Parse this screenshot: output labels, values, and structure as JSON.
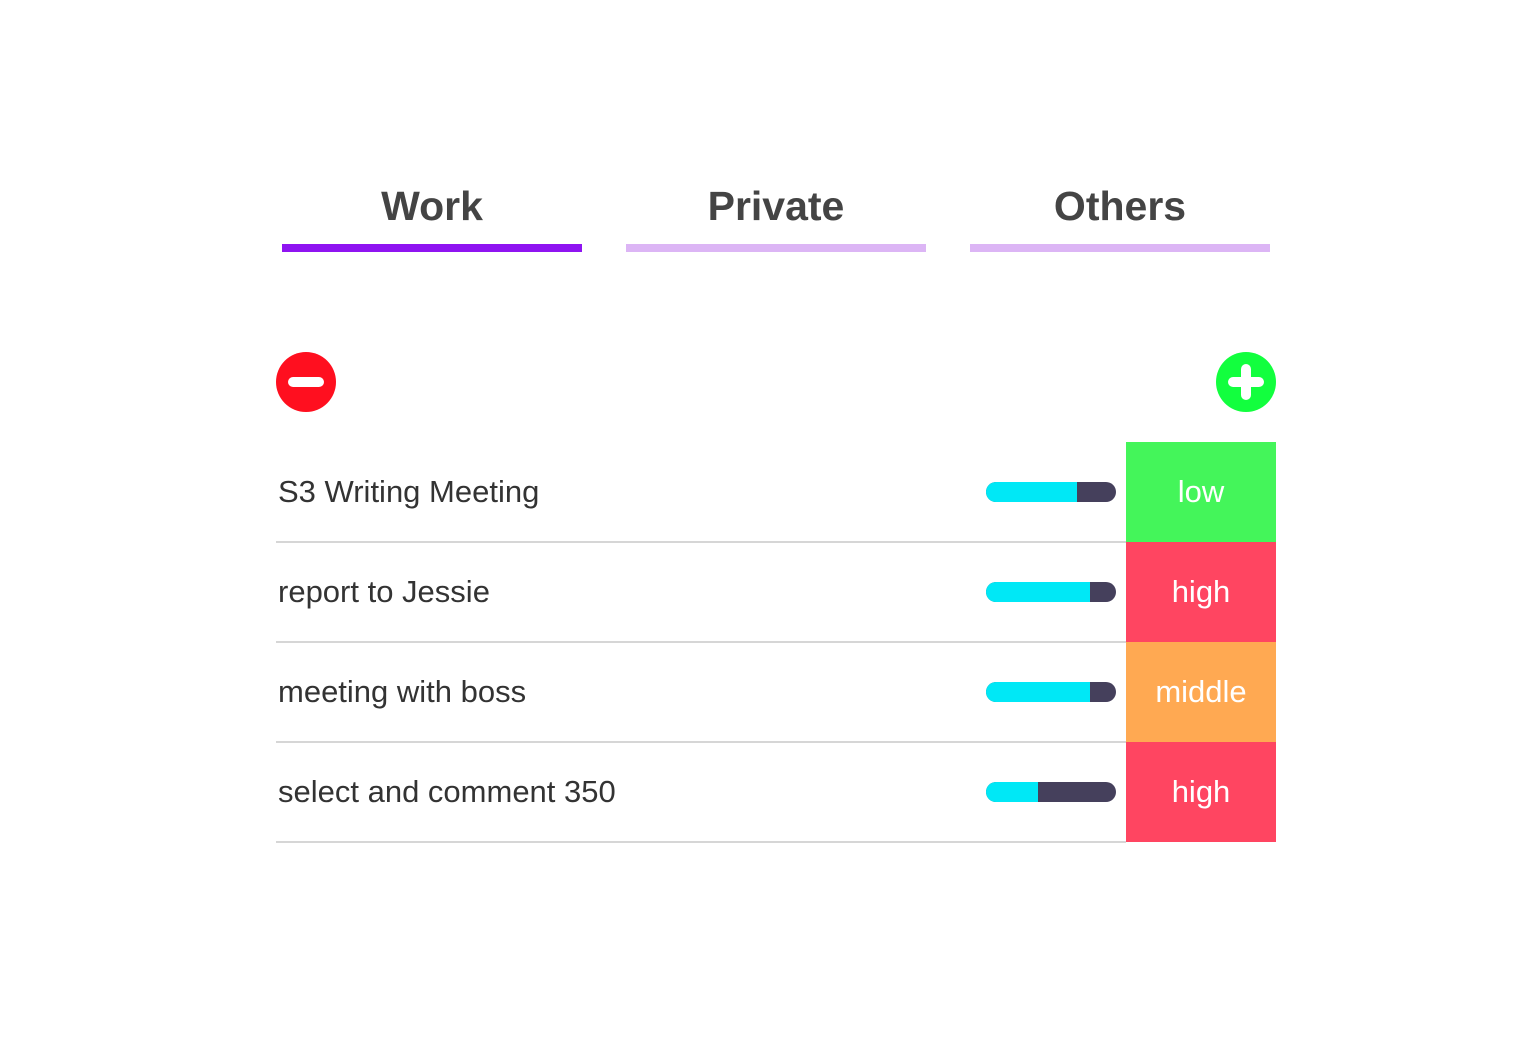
{
  "tabs": [
    {
      "label": "Work",
      "active": true
    },
    {
      "label": "Private",
      "active": false
    },
    {
      "label": "Others",
      "active": false
    }
  ],
  "colors": {
    "tab_active": "#8f14f1",
    "tab_inactive": "#dcb5f5",
    "remove_button": "#ff0f1f",
    "add_button": "#12ff3e",
    "progress_fill": "#00e8f6",
    "progress_track": "#45405c",
    "priority_low": "#44f55a",
    "priority_middle": "#ffa952",
    "priority_high": "#ff4561"
  },
  "toolbar": {
    "remove_icon": "minus-circle-icon",
    "add_icon": "plus-circle-icon"
  },
  "tasks": [
    {
      "title": "S3 Writing Meeting",
      "progress": 0.7,
      "priority": "low"
    },
    {
      "title": "report to Jessie",
      "progress": 0.8,
      "priority": "high"
    },
    {
      "title": "meeting with boss",
      "progress": 0.8,
      "priority": "middle"
    },
    {
      "title": "select and comment 350",
      "progress": 0.4,
      "priority": "high"
    }
  ]
}
